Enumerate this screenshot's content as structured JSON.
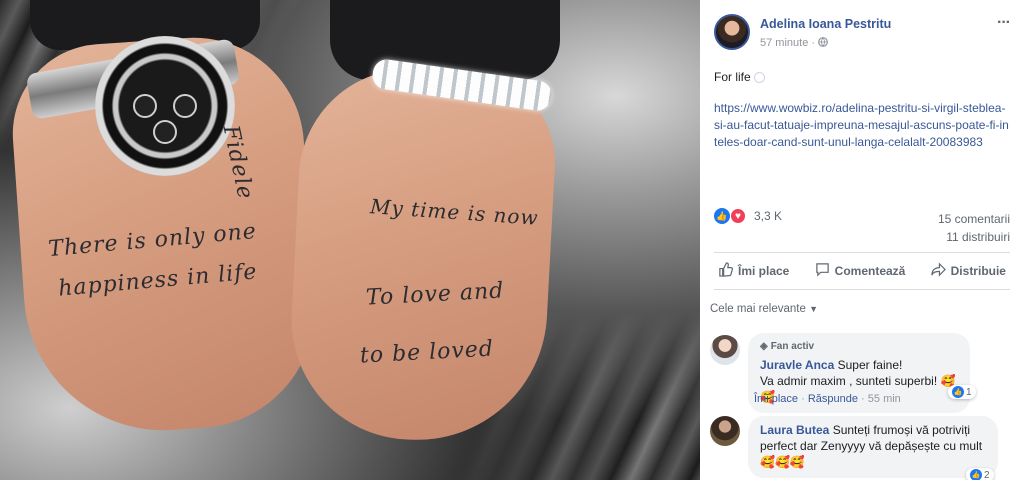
{
  "photo": {
    "tattoo_left_top": "Fidele",
    "tattoo_left_line1": "There is only one",
    "tattoo_left_line2": "happiness in life",
    "tattoo_right_line1": "My time is now",
    "tattoo_right_line2": "To love and",
    "tattoo_right_line3": "to be loved"
  },
  "post": {
    "author": "Adelina Ioana Pestritu",
    "time": "57 minute",
    "separator": "·",
    "more_icon": "···",
    "text": "For life",
    "link": "https://www.wowbiz.ro/adelina-pestritu-si-virgil-steblea-si-au-facut-tatuaje-impreuna-mesajul-ascuns-poate-fi-inteles-doar-cand-sunt-unul-langa-celalalt-20083983",
    "reaction_count": "3,3 K",
    "comments_count": "15 comentarii",
    "shares_count": "11 distribuiri"
  },
  "actions": {
    "like": "Îmi place",
    "comment": "Comentează",
    "share": "Distribuie"
  },
  "sort_label": "Cele mai relevante",
  "comments": [
    {
      "badge": "Fan activ",
      "name": "Juravle Anca",
      "text_line1": "Super faine!",
      "text_line2": "Va admir maxim , sunteti superbi!",
      "emoji": "🥰🥰",
      "like_label": "Îmi place",
      "reply_label": "Răspunde",
      "time": "55 min",
      "reactions": "1"
    },
    {
      "name": "Laura Butea",
      "text_line1": "Sunteți frumoși vă potriviți",
      "text_line2": "perfect dar Zenyyyy vă depășește cu mult",
      "emoji": "🥰🥰🥰",
      "reactions": "2"
    }
  ],
  "colors": {
    "link": "#385898",
    "like_blue": "#1877f2",
    "love_red": "#f33e58"
  }
}
